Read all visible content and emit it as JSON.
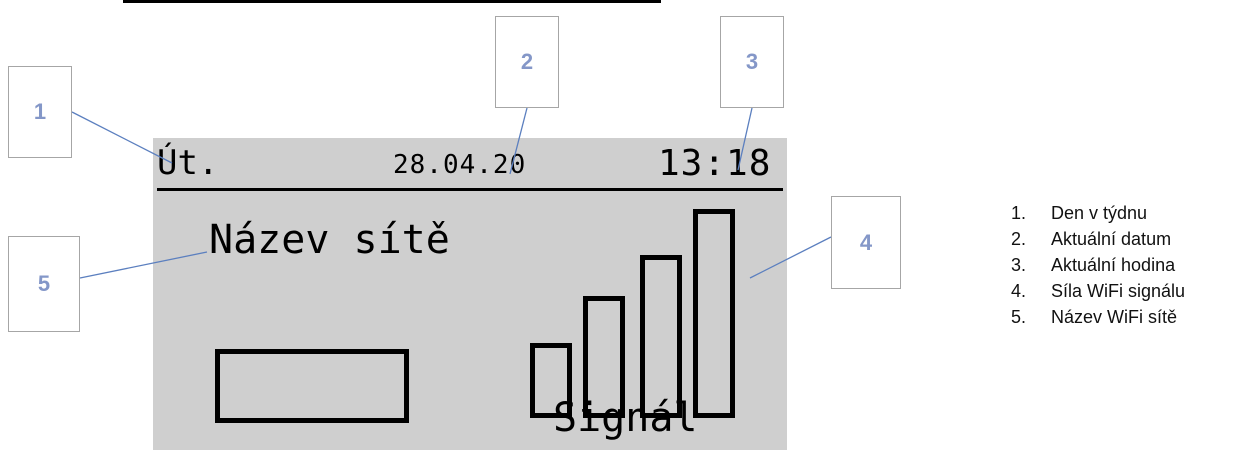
{
  "display": {
    "day": "Út.",
    "date": "28.04.20",
    "time": "13:18",
    "network_name": "Název sítě",
    "signal_label": "Signál",
    "signal_bars": 4
  },
  "callouts": [
    "1",
    "2",
    "3",
    "4",
    "5"
  ],
  "legend": [
    {
      "num": "1.",
      "text": "Den v týdnu"
    },
    {
      "num": "2.",
      "text": "Aktuální datum"
    },
    {
      "num": "3.",
      "text": "Aktuální hodina"
    },
    {
      "num": "4.",
      "text": "Síla WiFi signálu"
    },
    {
      "num": "5.",
      "text": "Název WiFi sítě"
    }
  ],
  "colors": {
    "lcd_background": "#cfcfcf",
    "callout_number": "#8497c8",
    "leader_line": "#5b7fbf"
  }
}
